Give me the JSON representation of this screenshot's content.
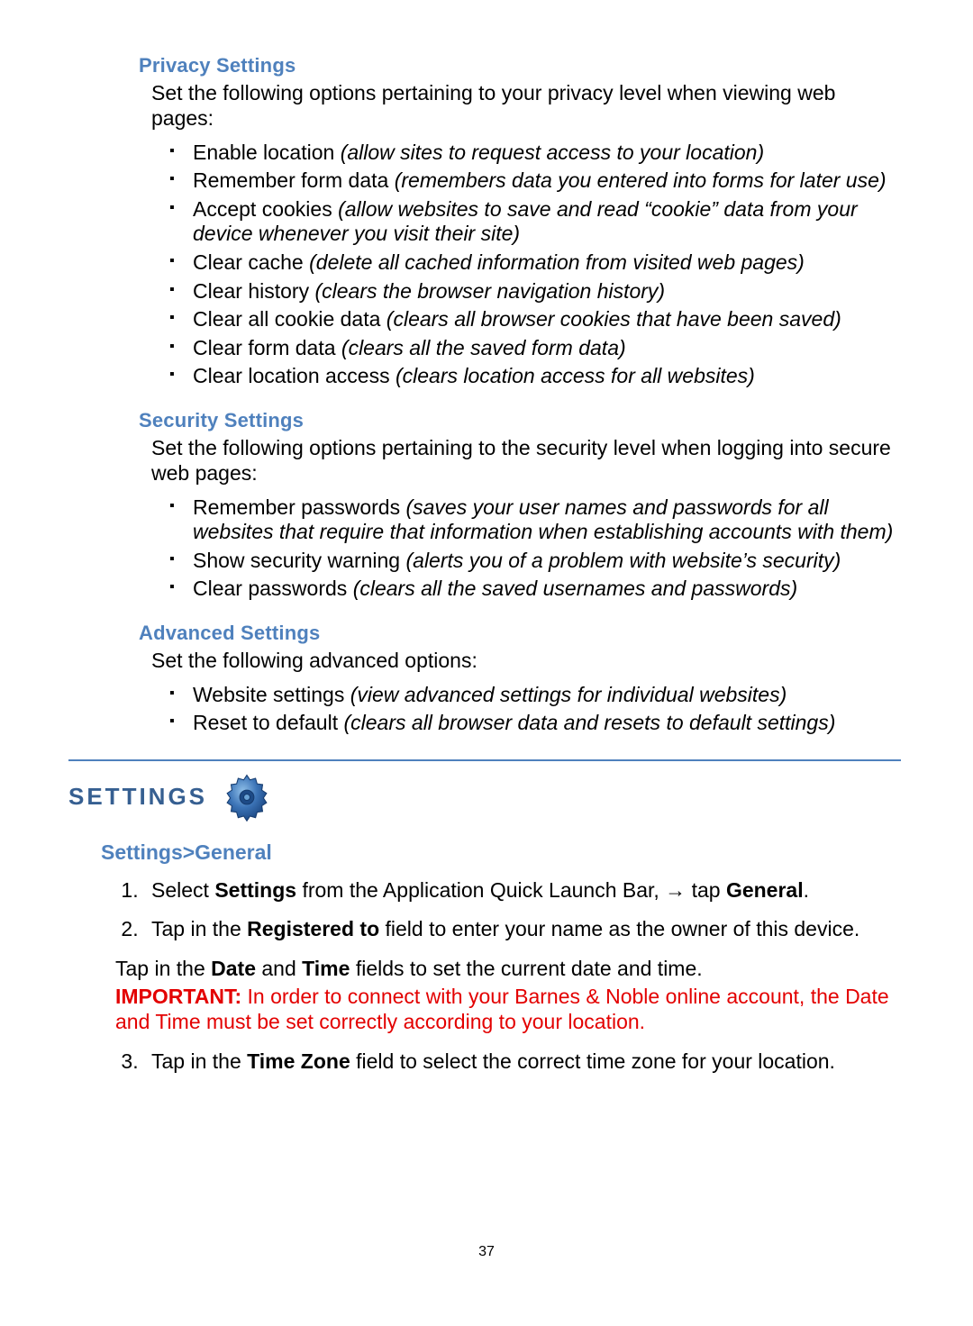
{
  "privacy": {
    "heading": "Privacy Settings",
    "intro": "Set the following options pertaining to your privacy level when viewing web pages:",
    "items": [
      {
        "label": "Enable location ",
        "desc": "(allow sites to request access to your location)"
      },
      {
        "label": "Remember form data ",
        "desc": "(remembers data you entered into forms for later use)"
      },
      {
        "label": "Accept cookies ",
        "desc": "(allow websites to save and read “cookie” data from your device whenever you visit their site)"
      },
      {
        "label": "Clear cache ",
        "desc": "(delete all cached information from visited web pages)"
      },
      {
        "label": "Clear history ",
        "desc": "(clears the browser navigation history)"
      },
      {
        "label": "Clear all cookie data ",
        "desc": "(clears all browser cookies that have been saved)"
      },
      {
        "label": "Clear form data ",
        "desc": "(clears all the saved form data)"
      },
      {
        "label": "Clear location access ",
        "desc": "(clears location access for all websites)"
      }
    ]
  },
  "security": {
    "heading": "Security Settings",
    "intro": "Set the following options pertaining to the security level when logging into secure web pages:",
    "items": [
      {
        "label": "Remember passwords ",
        "desc": "(saves your user names and passwords for all websites that require that information when establishing accounts with them)"
      },
      {
        "label": "Show security warning ",
        "desc": "(alerts you of a problem with website’s security)"
      },
      {
        "label": "Clear passwords ",
        "desc": "(clears all the saved usernames and passwords)"
      }
    ]
  },
  "advanced": {
    "heading": "Advanced Settings",
    "intro": "Set the following advanced options:",
    "items": [
      {
        "label": "Website settings ",
        "desc": "(view advanced settings for individual websites)"
      },
      {
        "label": "Reset to default ",
        "desc": "(clears all browser data and resets to default settings)"
      }
    ]
  },
  "settings": {
    "title": "SETTINGS",
    "sub": "Settings>General",
    "step1_pre": "Select ",
    "step1_b1": "Settings",
    "step1_mid": " from the Application Quick Launch Bar, → tap ",
    "step1_b2": "General",
    "step1_post": ".",
    "step2_pre": "Tap in the ",
    "step2_b": "Registered to",
    "step2_post": " field to enter your name as the owner of this device.",
    "para_pre": "Tap in the ",
    "para_b1": "Date",
    "para_mid1": " and ",
    "para_b2": "Time",
    "para_mid2": " fields to set the current date and time.",
    "imp_b": "IMPORTANT:",
    "imp_rest": " In order to connect with your Barnes & Noble online account, the Date and Time must be set correctly according to your location.",
    "step3_pre": "Tap in the ",
    "step3_b": "Time Zone",
    "step3_post": " field to select the correct time zone for your location."
  },
  "page_number": "37"
}
